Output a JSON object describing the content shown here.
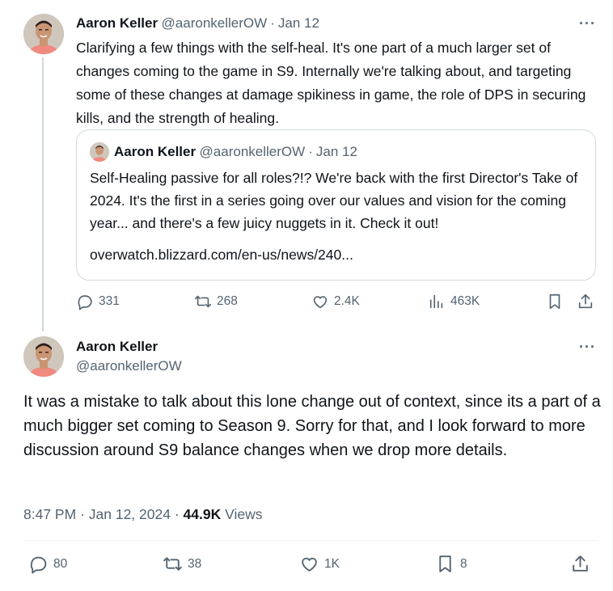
{
  "thread_tweet": {
    "author_name": "Aaron Keller",
    "author_handle": "@aaronkellerOW",
    "separator": "·",
    "date": "Jan 12",
    "text": "Clarifying a few things with the self-heal. It's one part of a much larger set of changes coming to the game in S9. Internally we're talking about, and targeting some of these changes at damage spikiness in game, the role of DPS in securing kills, and the strength of healing.",
    "more_icon": "more-horizontal-icon",
    "quoted": {
      "author_name": "Aaron Keller",
      "author_handle": "@aaronkellerOW",
      "separator": "·",
      "date": "Jan 12",
      "text": "Self-Healing passive for all roles?!? We're back with the first Director's Take of 2024. It's the first in a series going over our values and vision for the coming year... and there's a few juicy nuggets in it. Check it out!",
      "link": "overwatch.blizzard.com/en-us/news/240..."
    },
    "actions": {
      "replies": "331",
      "reposts": "268",
      "likes": "2.4K",
      "views": "463K"
    }
  },
  "main_tweet": {
    "author_name": "Aaron Keller",
    "author_handle": "@aaronkellerOW",
    "text": "It was a mistake to talk about this lone change out of context, since its a part of a much bigger set coming to Season 9. Sorry for that, and I look forward to more discussion around S9 balance changes when we drop more details.",
    "time": "8:47 PM",
    "meta_separator": "·",
    "date": "Jan 12, 2024",
    "views_count": "44.9K",
    "views_label": "Views",
    "actions": {
      "replies": "80",
      "reposts": "38",
      "likes": "1K",
      "bookmarks": "8"
    }
  },
  "colors": {
    "text_primary": "#0f1419",
    "text_secondary": "#536471",
    "border": "#cfd9de",
    "divider": "#eff3f4"
  }
}
